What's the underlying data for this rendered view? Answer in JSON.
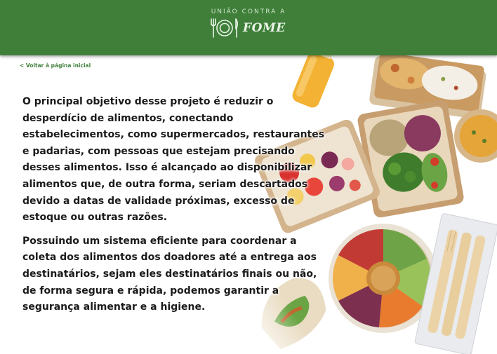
{
  "header": {
    "brand_tagline": "UNIÃO CONTRA A",
    "brand_word": "FOME",
    "background_color": "#3f7f3a"
  },
  "nav": {
    "back_link": "< Voltar à página inicial"
  },
  "main": {
    "paragraphs": [
      "O principal objetivo desse projeto é reduzir o desperdício de alimentos, conectando estabelecimentos, como supermercados, restaurantes e padarias, com pessoas que estejam precisando desses alimentos. Isso é alcançado ao disponibilizar alimentos que, de outra forma, seriam descartados devido a datas de validade próximas, excesso de estoque ou outras razões.",
      "Possuindo um sistema eficiente para coordenar a coleta dos alimentos dos doadores até a entrega aos destinatários, sejam eles destinatários finais ou não, de forma segura e rápida, podemos garantir a segurança alimentar e a higiene."
    ]
  },
  "decor": {
    "photo": "food-containers-illustration",
    "accent_color": "#3f7f3a"
  }
}
